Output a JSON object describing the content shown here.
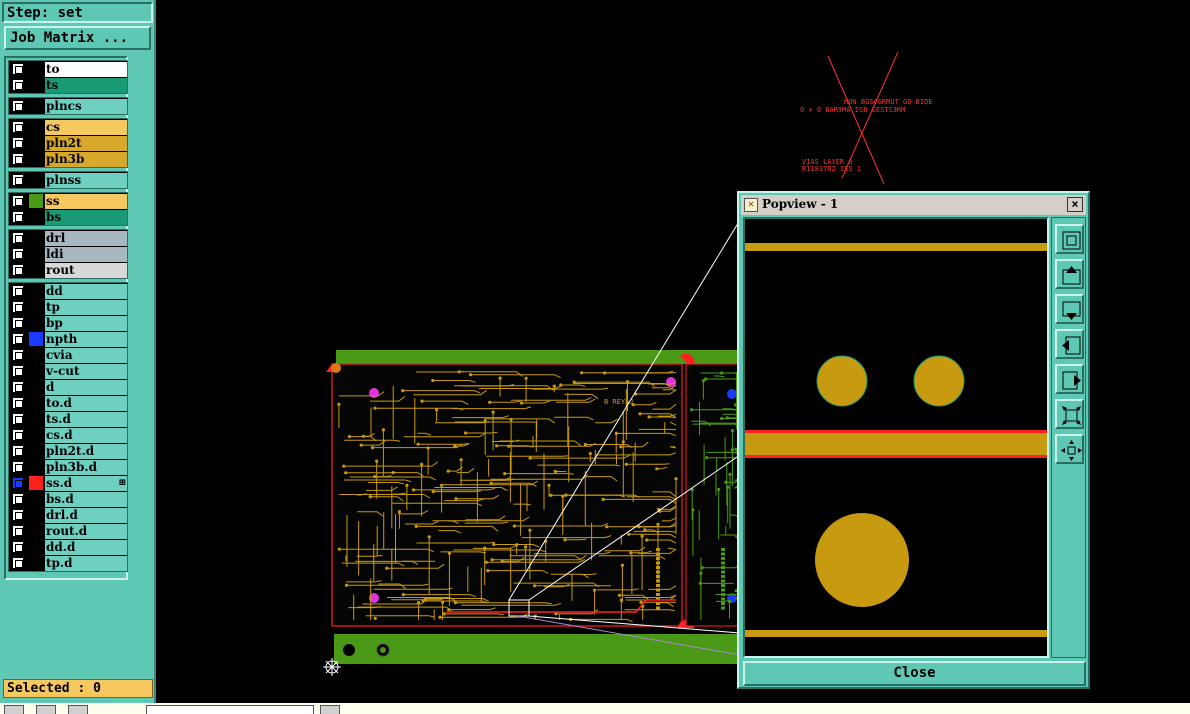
{
  "step_bar": {
    "label": "Step: set"
  },
  "job_matrix": {
    "label": "Job Matrix ..."
  },
  "layers": [
    {
      "name": "to",
      "color": "#ffffff",
      "swatch": "#000000"
    },
    {
      "name": "ts",
      "color": "#1a9a74",
      "swatch": "#000000"
    },
    {
      "name": "plncs",
      "color": "#6ed0c0",
      "swatch": "#000000"
    },
    {
      "name": "cs",
      "color": "#f8c860",
      "swatch": "#000000"
    },
    {
      "name": "pln2t",
      "color": "#d8a82c",
      "swatch": "#000000"
    },
    {
      "name": "pln3b",
      "color": "#d8a82c",
      "swatch": "#000000"
    },
    {
      "name": "plnss",
      "color": "#6ed0c0",
      "swatch": "#000000"
    },
    {
      "name": "ss",
      "color": "#f8c860",
      "swatch": "#4a9a18"
    },
    {
      "name": "bs",
      "color": "#1a9a74",
      "swatch": "#000000"
    },
    {
      "name": "drl",
      "color": "#a8b8c0",
      "swatch": "#000000"
    },
    {
      "name": "ldi",
      "color": "#a8b8c0",
      "swatch": "#000000"
    },
    {
      "name": "rout",
      "color": "#d8d8d8",
      "swatch": "#000000"
    },
    {
      "name": "dd",
      "color": "#6ed0c0",
      "swatch": "#000000"
    },
    {
      "name": "tp",
      "color": "#6ed0c0",
      "swatch": "#000000"
    },
    {
      "name": "bp",
      "color": "#6ed0c0",
      "swatch": "#000000"
    },
    {
      "name": "npth",
      "color": "#6ed0c0",
      "swatch": "#1a3aff"
    },
    {
      "name": "cvia",
      "color": "#6ed0c0",
      "swatch": "#000000"
    },
    {
      "name": "v-cut",
      "color": "#6ed0c0",
      "swatch": "#000000"
    },
    {
      "name": "d",
      "color": "#6ed0c0",
      "swatch": "#000000"
    },
    {
      "name": "to.d",
      "color": "#6ed0c0",
      "swatch": "#000000"
    },
    {
      "name": "ts.d",
      "color": "#6ed0c0",
      "swatch": "#000000"
    },
    {
      "name": "cs.d",
      "color": "#6ed0c0",
      "swatch": "#000000"
    },
    {
      "name": "pln2t.d",
      "color": "#6ed0c0",
      "swatch": "#000000"
    },
    {
      "name": "pln3b.d",
      "color": "#6ed0c0",
      "swatch": "#000000"
    },
    {
      "name": "ss.d",
      "color": "#6ed0c0",
      "swatch": "#ff2020",
      "active": true,
      "expand": "⊞"
    },
    {
      "name": "bs.d",
      "color": "#6ed0c0",
      "swatch": "#000000"
    },
    {
      "name": "drl.d",
      "color": "#6ed0c0",
      "swatch": "#000000"
    },
    {
      "name": "rout.d",
      "color": "#6ed0c0",
      "swatch": "#000000"
    },
    {
      "name": "dd.d",
      "color": "#6ed0c0",
      "swatch": "#000000"
    },
    {
      "name": "tp.d",
      "color": "#6ed0c0",
      "swatch": "#000000"
    }
  ],
  "selected": {
    "label": "Selected : 0"
  },
  "popview": {
    "title": "Popview - 1",
    "close_x": "×",
    "close_label": "Close",
    "tools": [
      "zoom-fit-icon",
      "pan-up-icon",
      "pan-down-icon",
      "pan-left-icon",
      "pan-right-icon",
      "zoom-out-icon",
      "zoom-in-icon"
    ]
  },
  "board_text": {
    "upper_1": "MON BGSCGRMUT GD BIDE",
    "upper_2": "0 + 0 BAR9MA   ISB  SESTS3RM",
    "lower_1": "VIAS   LAYER 0",
    "lower_2": "R1183782   ISS 1",
    "board_label": "B REYAJ"
  },
  "colors": {
    "panel": "#5ec8b4",
    "board_green": "#4a9a18",
    "trace": "#c89a10",
    "outline": "#ff2020"
  }
}
